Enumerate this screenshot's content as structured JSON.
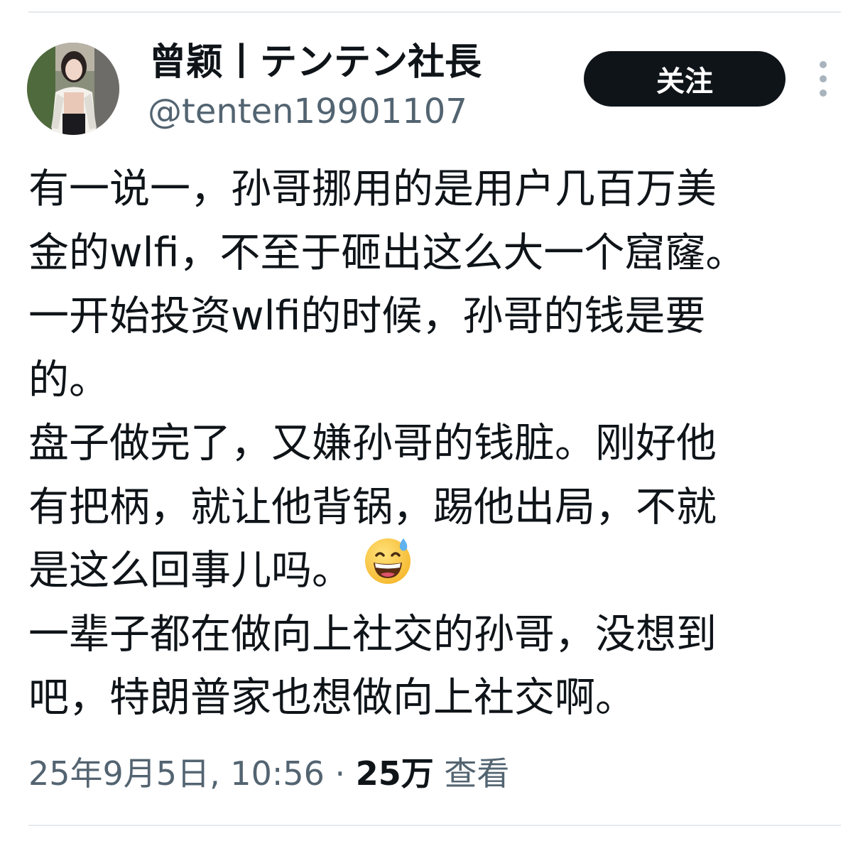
{
  "user": {
    "display_name": "曾颖丨テンテン社長",
    "handle": "@tenten19901107"
  },
  "follow_button": {
    "label": "关注"
  },
  "more_button": {
    "icon": "more-vertical-icon"
  },
  "tweet": {
    "lines": [
      "有一说一，孙哥挪用的是用户几百万美",
      "金的wlfi，不至于砸出这么大一个窟窿。",
      "一开始投资wlfi的时候，孙哥的钱是要",
      "的。",
      "盘子做完了，又嫌孙哥的钱脏。刚好他",
      "有把柄，就让他背锅，踢他出局，不就",
      "是这么回事儿吗。",
      "一辈子都在做向上社交的孙哥，没想到",
      "吧，特朗普家也想做向上社交啊。"
    ],
    "emoji": "grinning-face-with-sweat-icon"
  },
  "meta": {
    "timestamp": "25年9月5日, 10:56",
    "separator": "·",
    "views_count": "25万",
    "views_label": "查看"
  },
  "colors": {
    "text_primary": "#0f1419",
    "text_secondary": "#536471",
    "button_bg": "#0f1419",
    "button_text": "#ffffff",
    "divider": "#e5e9ec"
  }
}
